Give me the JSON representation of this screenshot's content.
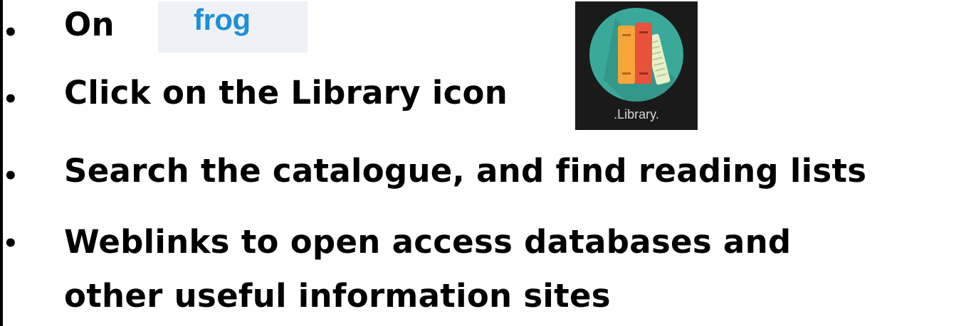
{
  "bullets": [
    {
      "marker": "•",
      "text": "On"
    },
    {
      "marker": "•",
      "text": "Click on the Library icon"
    },
    {
      "marker": "•",
      "text": "Search the catalogue, and find reading lists"
    },
    {
      "marker": "•",
      "text": "Weblinks to open access databases and"
    }
  ],
  "continuation": "other useful information sites",
  "frog_logo": {
    "text": "frog",
    "color": "#1e8fd8"
  },
  "library_tile": {
    "caption": ".Library.",
    "icon": "books-icon",
    "circle_color": "#3aa99a"
  }
}
